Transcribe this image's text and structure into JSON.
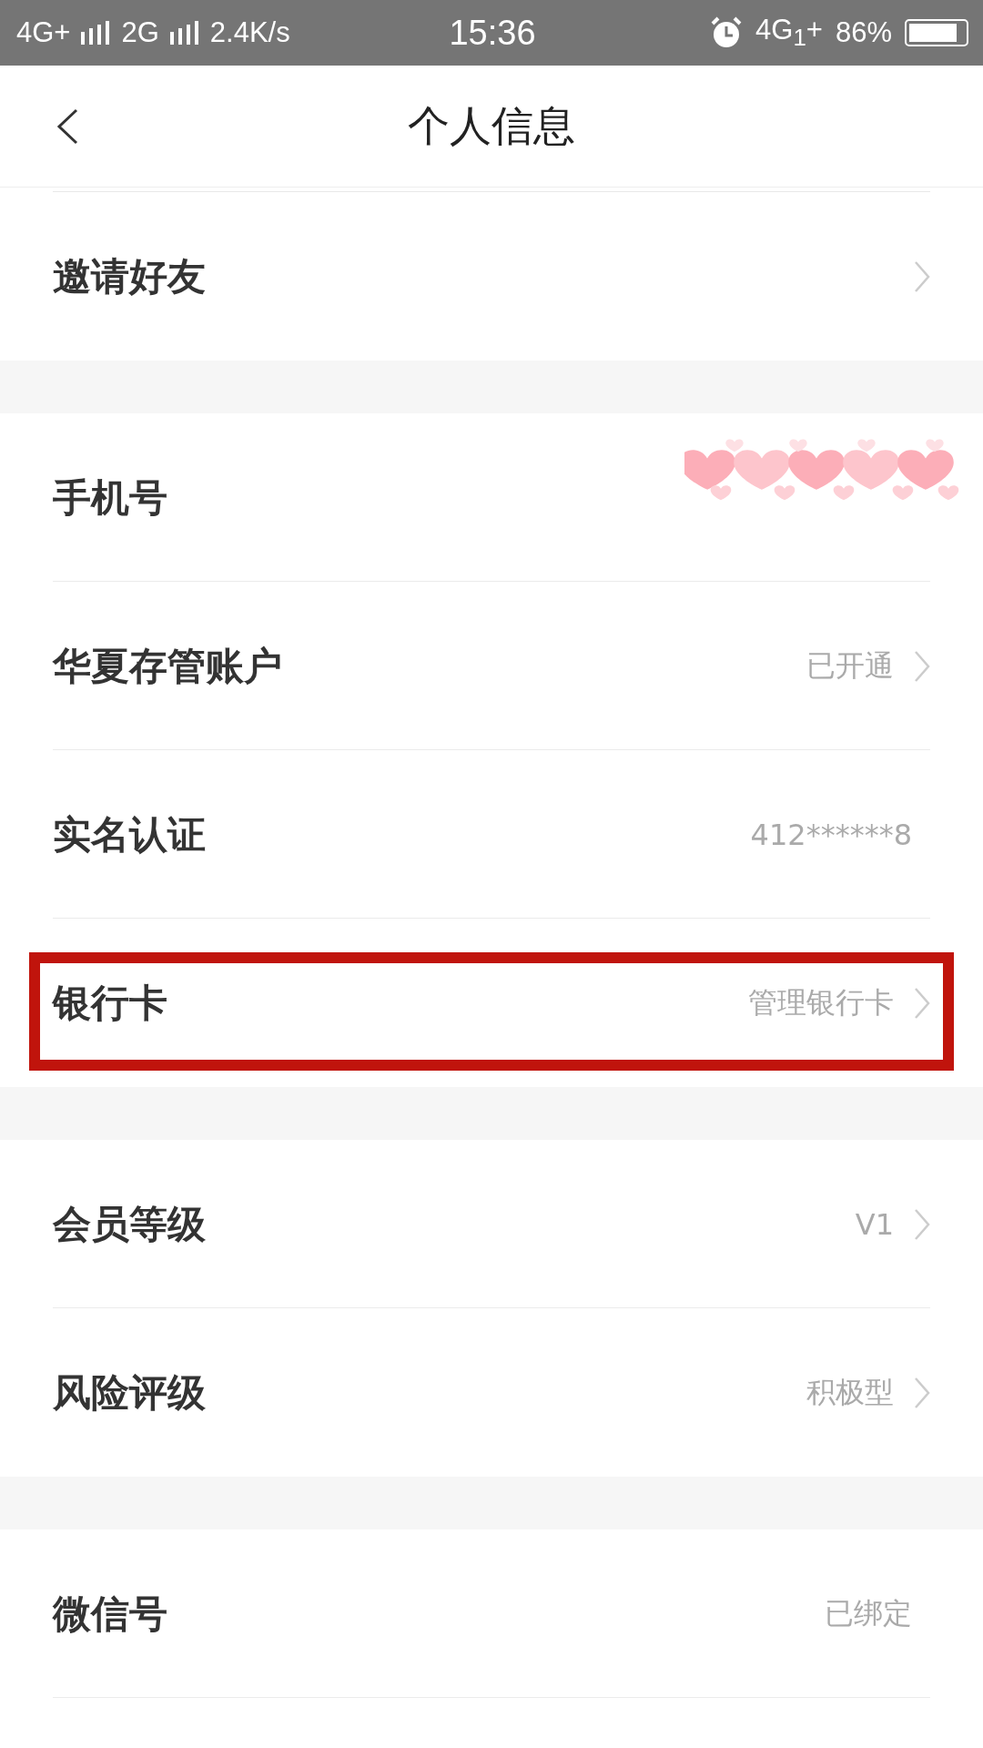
{
  "status_bar": {
    "network_1": "4G+",
    "network_2": "2G",
    "speed": "2.4K/s",
    "time": "15:36",
    "network_3": "4G$_{1}$+",
    "battery": "86%"
  },
  "header": {
    "title": "个人信息"
  },
  "sections": [
    {
      "rows": [
        {
          "label": "邀请好友",
          "chevron": true,
          "redacted": false,
          "highlighted": false
        }
      ]
    },
    {
      "rows": [
        {
          "label": "手机号",
          "chevron": false,
          "redacted": true,
          "highlighted": false
        },
        {
          "label": "华夏存管账户",
          "value": "已开通",
          "chevron": true,
          "redacted": false,
          "highlighted": false
        },
        {
          "label": "实名认证",
          "value": "412******8",
          "chevron": false,
          "redacted": false,
          "highlighted": false
        },
        {
          "label": "银行卡",
          "value": "管理银行卡",
          "chevron": true,
          "redacted": false,
          "highlighted": true
        }
      ]
    },
    {
      "rows": [
        {
          "label": "会员等级",
          "value": "V1",
          "chevron": true,
          "redacted": false,
          "highlighted": false
        },
        {
          "label": "风险评级",
          "value": "积极型",
          "chevron": true,
          "redacted": false,
          "highlighted": false
        }
      ]
    },
    {
      "rows": [
        {
          "label": "微信号",
          "value": "已绑定",
          "chevron": false,
          "redacted": false,
          "highlighted": false
        }
      ]
    }
  ]
}
